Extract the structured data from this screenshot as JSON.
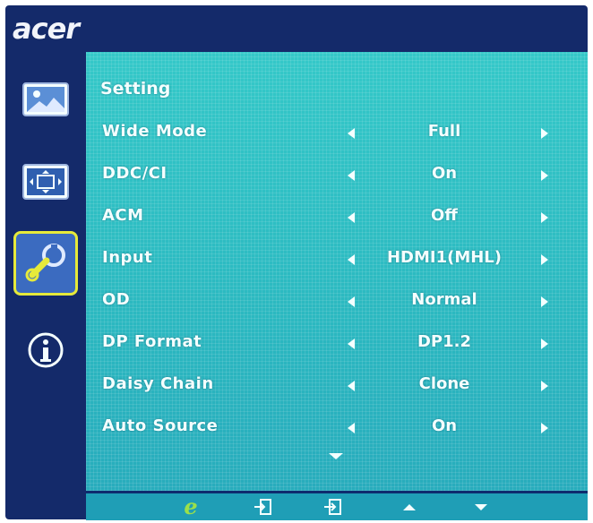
{
  "brand": {
    "logo_text": "acer"
  },
  "colors": {
    "frame": "#142a6a",
    "panel": "#2bc0c4",
    "selected_border": "#e6ea3a",
    "text": "#f4ffff",
    "eco_icon": "#9be04a"
  },
  "sidebar": {
    "items": [
      {
        "icon": "picture-icon",
        "selected": false
      },
      {
        "icon": "display-position-icon",
        "selected": false
      },
      {
        "icon": "settings-wrench-icon",
        "selected": true
      },
      {
        "icon": "info-icon",
        "selected": false
      }
    ]
  },
  "panel": {
    "title": "Setting",
    "rows": [
      {
        "label": "Wide Mode",
        "value": "Full"
      },
      {
        "label": "DDC/CI",
        "value": "On"
      },
      {
        "label": "ACM",
        "value": "Off"
      },
      {
        "label": "Input",
        "value": "HDMI1(MHL)"
      },
      {
        "label": "OD",
        "value": "Normal"
      },
      {
        "label": "DP Format",
        "value": "DP1.2"
      },
      {
        "label": "Daisy Chain",
        "value": "Clone"
      },
      {
        "label": "Auto Source",
        "value": "On"
      }
    ]
  },
  "bottom_bar": {
    "buttons": [
      {
        "icon": "eco-e-icon",
        "text": "e"
      },
      {
        "icon": "input-exit-icon"
      },
      {
        "icon": "enter-icon"
      },
      {
        "icon": "up-arrow-icon"
      },
      {
        "icon": "down-arrow-icon"
      }
    ]
  }
}
